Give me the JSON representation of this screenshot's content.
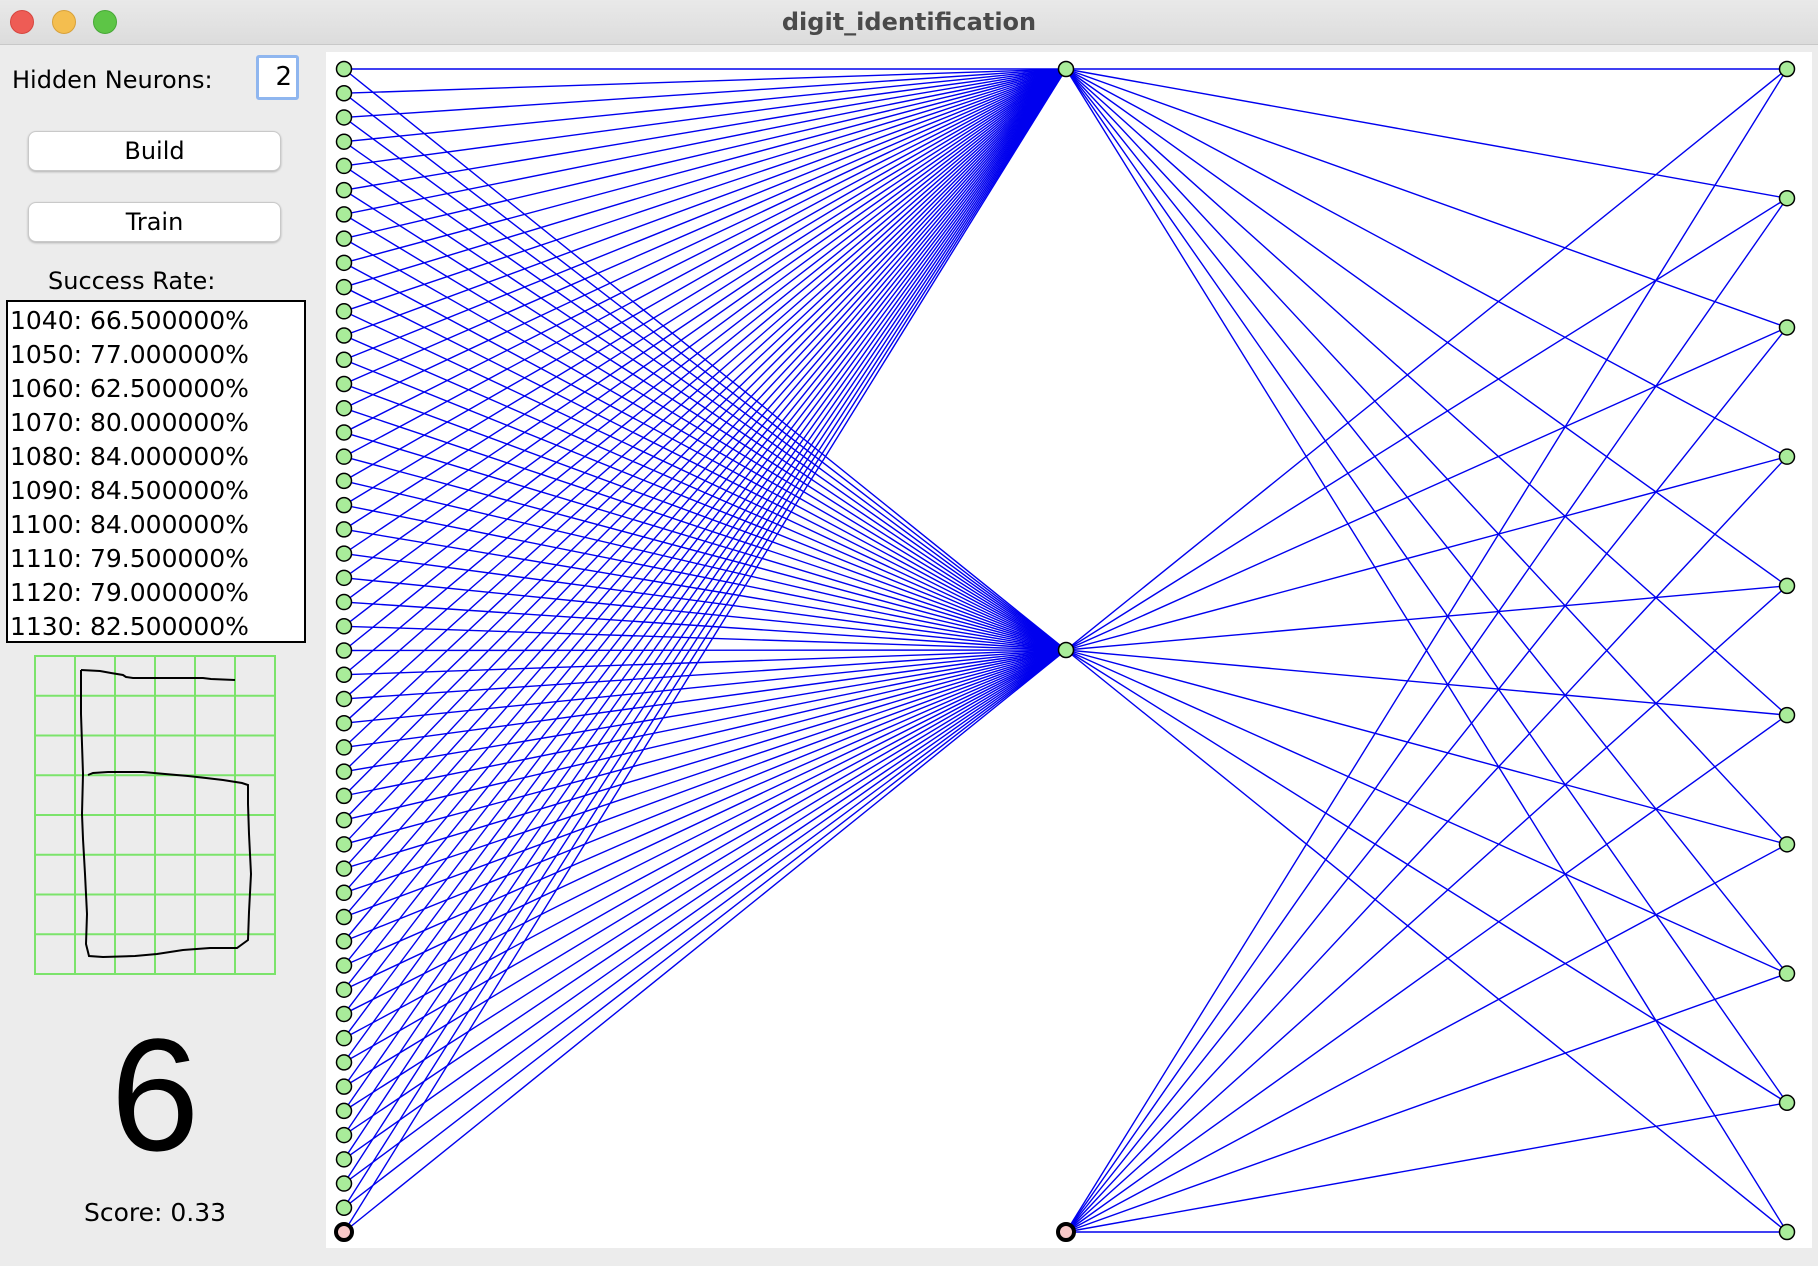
{
  "window": {
    "title": "digit_identification"
  },
  "controls": {
    "hidden_neurons_label": "Hidden Neurons:",
    "hidden_neurons_value": "2",
    "build_label": "Build",
    "train_label": "Train",
    "success_rate_label": "Success Rate:"
  },
  "success_rates": [
    "1040: 66.500000%",
    "1050: 77.000000%",
    "1060: 62.500000%",
    "1070: 80.000000%",
    "1080: 84.000000%",
    "1090: 84.500000%",
    "1100: 84.000000%",
    "1110: 79.500000%",
    "1120: 79.000000%",
    "1130: 82.500000%"
  ],
  "drawing_grid": {
    "columns": 6,
    "rows": 8,
    "grid_color": "#7be36b",
    "stroke_color": "#000000"
  },
  "prediction": {
    "digit": "6",
    "score_text": "Score: 0.33"
  },
  "network": {
    "input_neurons": 48,
    "hidden_neurons": 2,
    "output_neurons": 10,
    "has_input_bias": true,
    "has_hidden_bias": true,
    "edge_color": "#0000ee",
    "node_fill": "#a9ec9a",
    "bias_fill": "#f8c8c8"
  }
}
